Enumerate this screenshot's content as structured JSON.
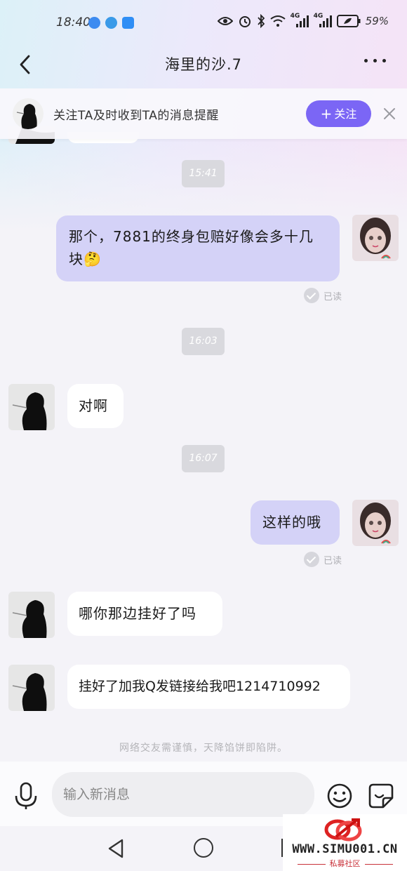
{
  "status_bar": {
    "time": "18:40",
    "battery": "59%",
    "network_1": "4G",
    "network_2": "4G"
  },
  "header": {
    "title": "海里的沙.7"
  },
  "follow_bar": {
    "text": "关注TA及时收到TA的消息提醒",
    "button_label": "关注"
  },
  "messages": [
    {
      "type": "timestamp",
      "text": "15:41"
    },
    {
      "type": "sent",
      "text_line1": "那个，7881的终身包赔好像会多十几",
      "text_line2": "块🤔",
      "read_label": "已读"
    },
    {
      "type": "timestamp",
      "text": "16:03"
    },
    {
      "type": "received",
      "text": "对啊"
    },
    {
      "type": "timestamp",
      "text": "16:07"
    },
    {
      "type": "sent",
      "text": "这样的哦",
      "read_label": "已读"
    },
    {
      "type": "received",
      "text": "哪你那边挂好了吗"
    },
    {
      "type": "received",
      "text": "挂好了加我Q发链接给我吧1214710992"
    }
  ],
  "notice": "网络交友需谨慎，天降馅饼即陷阱。",
  "composer": {
    "placeholder": "输入新消息"
  },
  "watermark": {
    "site": "WWW.SIMU001.CN",
    "subtitle": "私募社区"
  },
  "colors": {
    "accent": "#7b66f5",
    "sent_bubble": "#d4d2f7",
    "received_bubble": "#ffffff",
    "timestamp_bg": "#d9d9de"
  },
  "icons": [
    "back-icon",
    "more-icon",
    "close-icon",
    "mic-icon",
    "emoji-icon",
    "sticker-icon",
    "nav-back-icon",
    "nav-home-icon",
    "nav-recent-icon"
  ]
}
